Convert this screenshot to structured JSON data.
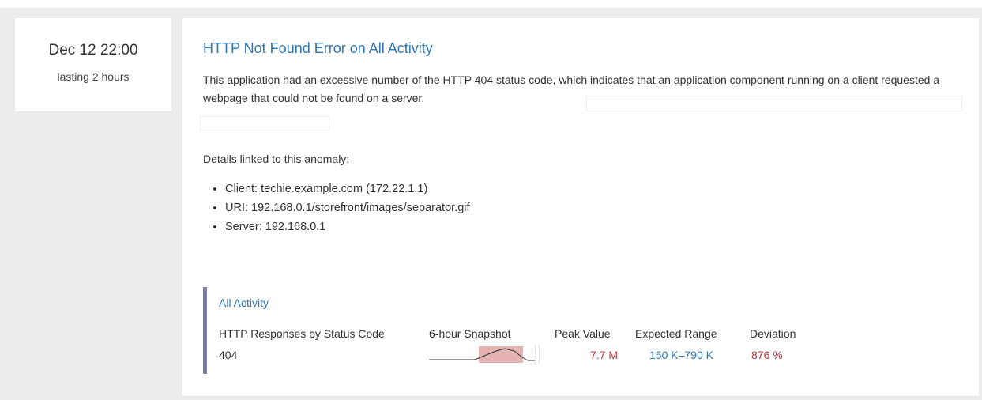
{
  "event": {
    "date": "Dec 12 22:00",
    "duration": "lasting 2 hours"
  },
  "anomaly": {
    "title": "HTTP Not Found Error on All Activity",
    "description": "This application had an excessive number of the HTTP 404 status code, which indicates that an application component running on a client requested a webpage that could not be found on a server.",
    "details_heading": "Details linked to this anomaly:",
    "details": [
      "Client: techie.example.com (172.22.1.1)",
      "URI: 192.168.0.1/storefront/images/separator.gif",
      "Server: 192.168.0.1"
    ]
  },
  "metric": {
    "source": "All Activity",
    "headers": {
      "metric": "HTTP Responses by Status Code",
      "snapshot": "6-hour Snapshot",
      "peak": "Peak Value",
      "expected": "Expected Range",
      "deviation": "Deviation"
    },
    "row": {
      "label": "404",
      "peak": "7.7 M",
      "expected": "150 K–790 K",
      "deviation": "876 %"
    }
  },
  "colors": {
    "link": "#2f78b2",
    "alert": "#b5373c",
    "accent_bar": "#7b7ea8",
    "highlight": "#e6b3b5"
  }
}
